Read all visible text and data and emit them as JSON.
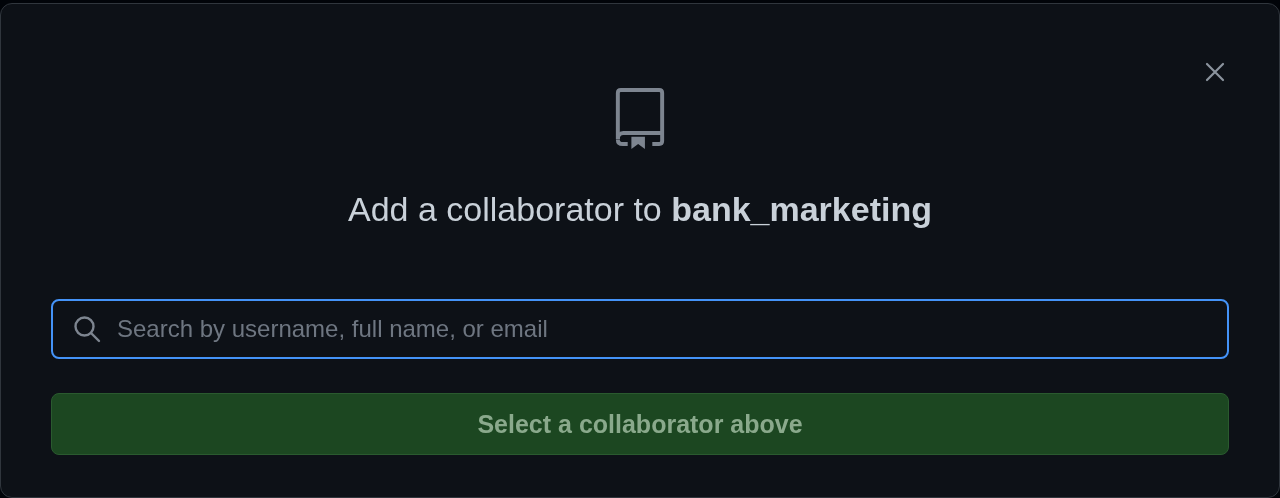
{
  "dialog": {
    "title": "Add a collaborator to **bank_marketing**",
    "search": {
      "placeholder": "Search by username, full name, or email",
      "focused": true
    },
    "submit_button": {
      "label": "Select a collaborator above",
      "disabled": true
    }
  }
}
